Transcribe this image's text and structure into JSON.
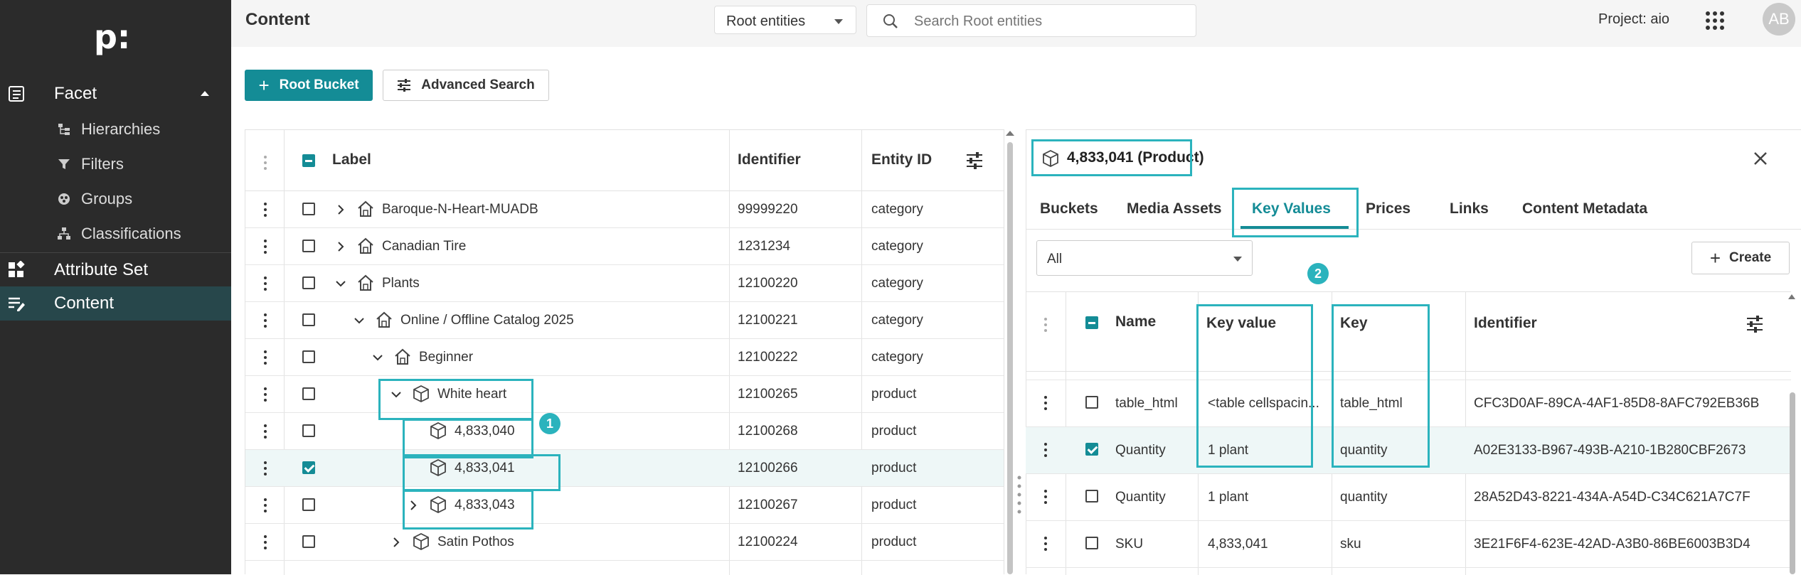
{
  "sidebar": {
    "logo": "p:",
    "items": [
      {
        "label": "Facet",
        "icon": "facet-icon"
      },
      {
        "label": "Hierarchies",
        "icon": "hierarchy-icon"
      },
      {
        "label": "Filters",
        "icon": "filter-icon"
      },
      {
        "label": "Groups",
        "icon": "groups-icon"
      },
      {
        "label": "Classifications",
        "icon": "classification-icon"
      },
      {
        "label": "Attribute Set",
        "icon": "attribute-set-icon"
      },
      {
        "label": "Content",
        "icon": "content-icon"
      }
    ]
  },
  "header": {
    "title": "Content",
    "scope": "Root entities",
    "search_placeholder": "Search Root entities",
    "project": "Project: aio",
    "avatar": "AB"
  },
  "toolbar": {
    "root_bucket": "Root Bucket",
    "advanced_search": "Advanced Search"
  },
  "tree": {
    "columns": [
      "Label",
      "Identifier",
      "Entity ID"
    ],
    "rows": [
      {
        "label": "Baroque-N-Heart-MUADB",
        "identifier": "99999220",
        "entity": "category"
      },
      {
        "label": "Canadian Tire",
        "identifier": "1231234",
        "entity": "category"
      },
      {
        "label": "Plants",
        "identifier": "12100220",
        "entity": "category"
      },
      {
        "label": "Online / Offline Catalog 2025",
        "identifier": "12100221",
        "entity": "category"
      },
      {
        "label": "Beginner",
        "identifier": "12100222",
        "entity": "category"
      },
      {
        "label": "White heart",
        "identifier": "12100265",
        "entity": "product"
      },
      {
        "label": "4,833,040",
        "identifier": "12100268",
        "entity": "product"
      },
      {
        "label": "4,833,041",
        "identifier": "12100266",
        "entity": "product"
      },
      {
        "label": "4,833,043",
        "identifier": "12100267",
        "entity": "product"
      },
      {
        "label": "Satin Pothos",
        "identifier": "12100224",
        "entity": "product"
      }
    ]
  },
  "detail": {
    "title": "4,833,041 (Product)",
    "tabs": [
      "Buckets",
      "Media Assets",
      "Key Values",
      "Prices",
      "Links",
      "Content Metadata"
    ],
    "active_tab": "Key Values",
    "filter": "All",
    "create": "Create",
    "columns": [
      "Name",
      "Key value",
      "Key",
      "Identifier"
    ],
    "rows": [
      {
        "name": "table_html",
        "key_value": "<table cellspacin...",
        "key": "table_html",
        "identifier": "CFC3D0AF-89CA-4AF1-85D8-8AFC792EB36B"
      },
      {
        "name": "Quantity",
        "key_value": "1 plant",
        "key": "quantity",
        "identifier": "A02E3133-B967-493B-A210-1B280CBF2673"
      },
      {
        "name": "Quantity",
        "key_value": "1 plant",
        "key": "quantity",
        "identifier": "28A52D43-8221-434A-A54D-C34C621A7C7F"
      },
      {
        "name": "SKU",
        "key_value": "4,833,041",
        "key": "sku",
        "identifier": "3E21F6F4-623E-42AD-A3B0-86BE6003B3D4"
      }
    ]
  },
  "annotations": {
    "badge1": "1",
    "badge2": "2"
  },
  "colors": {
    "accent": "#148c96",
    "highlight": "#2bb3bd",
    "sidebar": "#2b2b2b"
  }
}
